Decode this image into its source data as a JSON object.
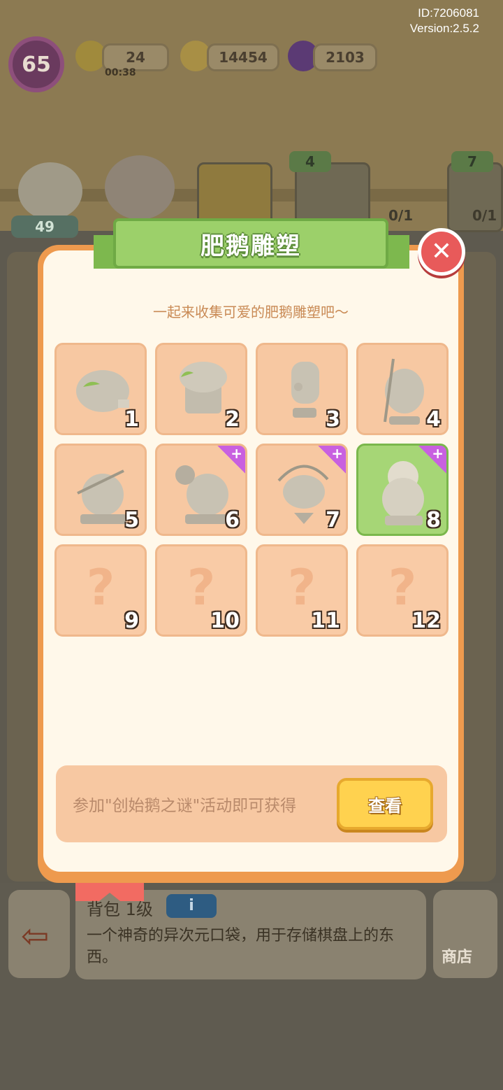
{
  "meta": {
    "id": "ID:7206081",
    "version": "Version:2.5.2"
  },
  "hud": {
    "level": "65",
    "energy": "24",
    "energy_timer": "00:38",
    "coins": "14454",
    "gems": "2103"
  },
  "scene": {
    "star_count": "49",
    "card_badges": [
      "4",
      "7"
    ],
    "card_progress": [
      "0/1",
      "0/1"
    ]
  },
  "modal": {
    "title": "肥鹅雕塑",
    "subtitle": "一起来收集可爱的肥鹅雕塑吧～",
    "tiles": [
      {
        "num": "1",
        "icon": "mossy-rock-icon",
        "state": "owned",
        "new": false
      },
      {
        "num": "2",
        "icon": "mossy-pedestal-icon",
        "state": "owned",
        "new": false
      },
      {
        "num": "3",
        "icon": "goose-bust-icon",
        "state": "owned",
        "new": false
      },
      {
        "num": "4",
        "icon": "goose-bow-statue-icon",
        "state": "owned",
        "new": false
      },
      {
        "num": "5",
        "icon": "goose-thinker-statue-icon",
        "state": "owned",
        "new": false
      },
      {
        "num": "6",
        "icon": "goose-squirrel-statue-icon",
        "state": "owned",
        "new": true
      },
      {
        "num": "7",
        "icon": "goose-archer-statue-icon",
        "state": "owned",
        "new": true
      },
      {
        "num": "8",
        "icon": "goose-david-statue-icon",
        "state": "selected",
        "new": true
      },
      {
        "num": "9",
        "icon": "question-mark-icon",
        "state": "locked",
        "new": false
      },
      {
        "num": "10",
        "icon": "question-mark-icon",
        "state": "locked",
        "new": false
      },
      {
        "num": "11",
        "icon": "question-mark-icon",
        "state": "locked",
        "new": false
      },
      {
        "num": "12",
        "icon": "question-mark-icon",
        "state": "locked",
        "new": false
      }
    ],
    "footer_text": "参加\"创始鹅之谜\"活动即可获得",
    "view_button": "查看",
    "close_icon": "close-icon",
    "new_badge": "+"
  },
  "bottom": {
    "title": "背包 1级",
    "info_badge": "i",
    "description": "一个神奇的异次元口袋，用于存储棋盘上的东西。",
    "shop_label": "商店"
  },
  "colors": {
    "modal_border": "#ee9a4e",
    "modal_bg": "#fff8ea",
    "banner_green": "#9cd06a",
    "tile_bg": "#f7c8a2",
    "tile_selected": "#a6d676",
    "new_flag": "#c860e0",
    "close_red": "#e85a5a",
    "button_yellow": "#ffd24f"
  }
}
